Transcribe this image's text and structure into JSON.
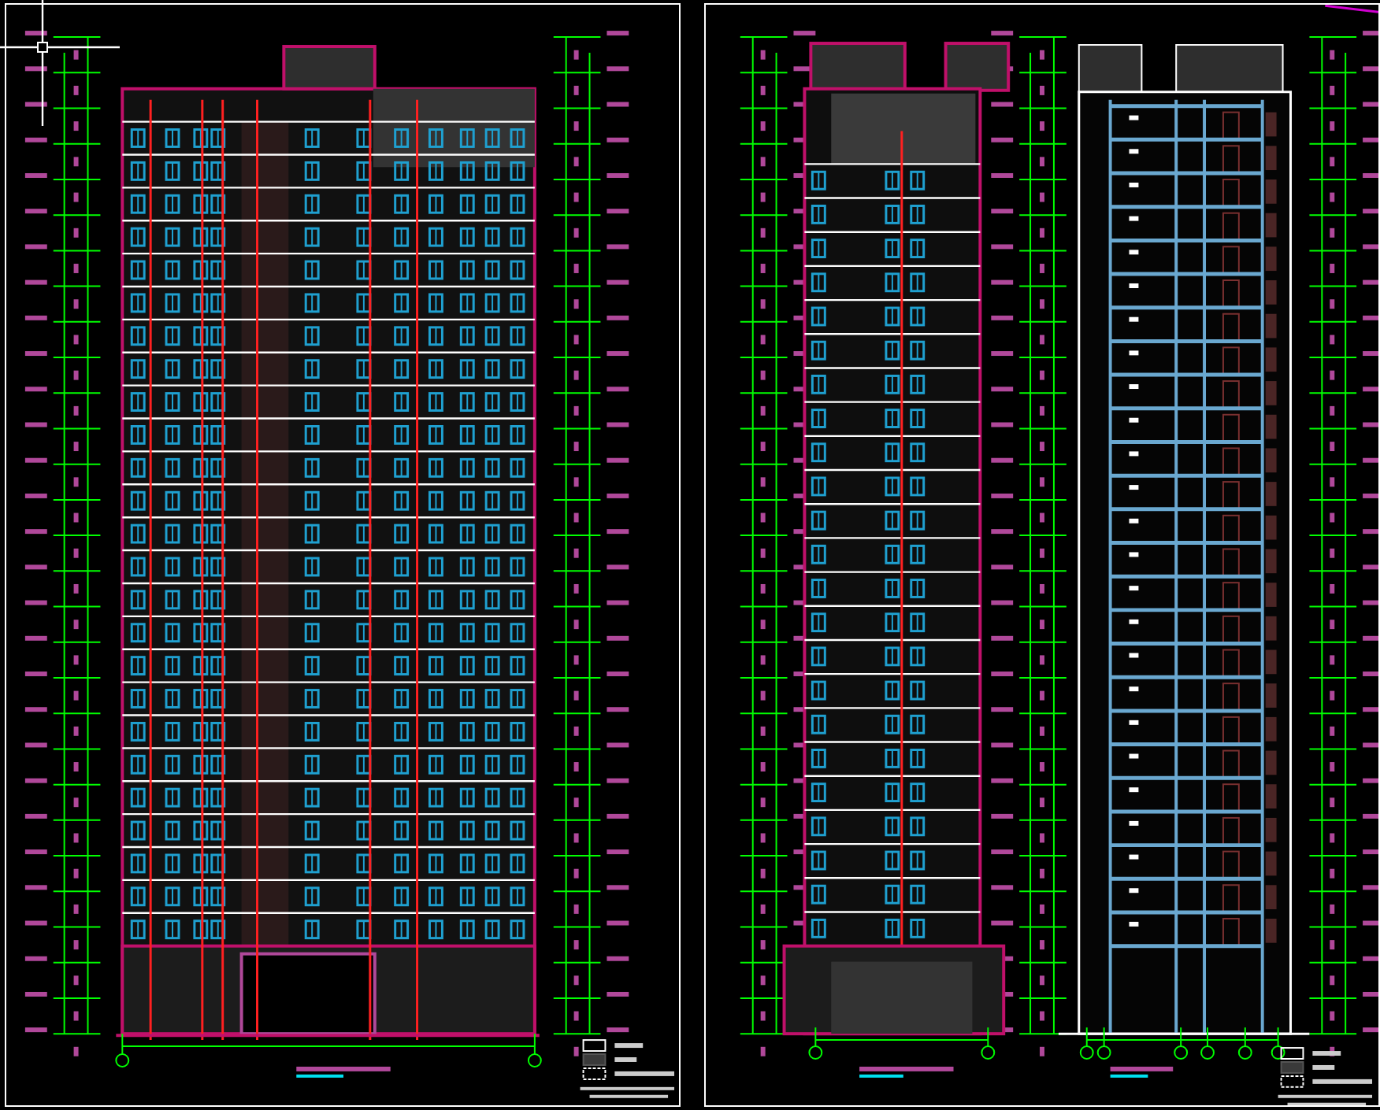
{
  "cursor": {
    "kind": "crosshair"
  },
  "sheets": [
    {
      "kind": "front_elevation"
    },
    {
      "kind": "side_elevation_and_section"
    }
  ]
}
